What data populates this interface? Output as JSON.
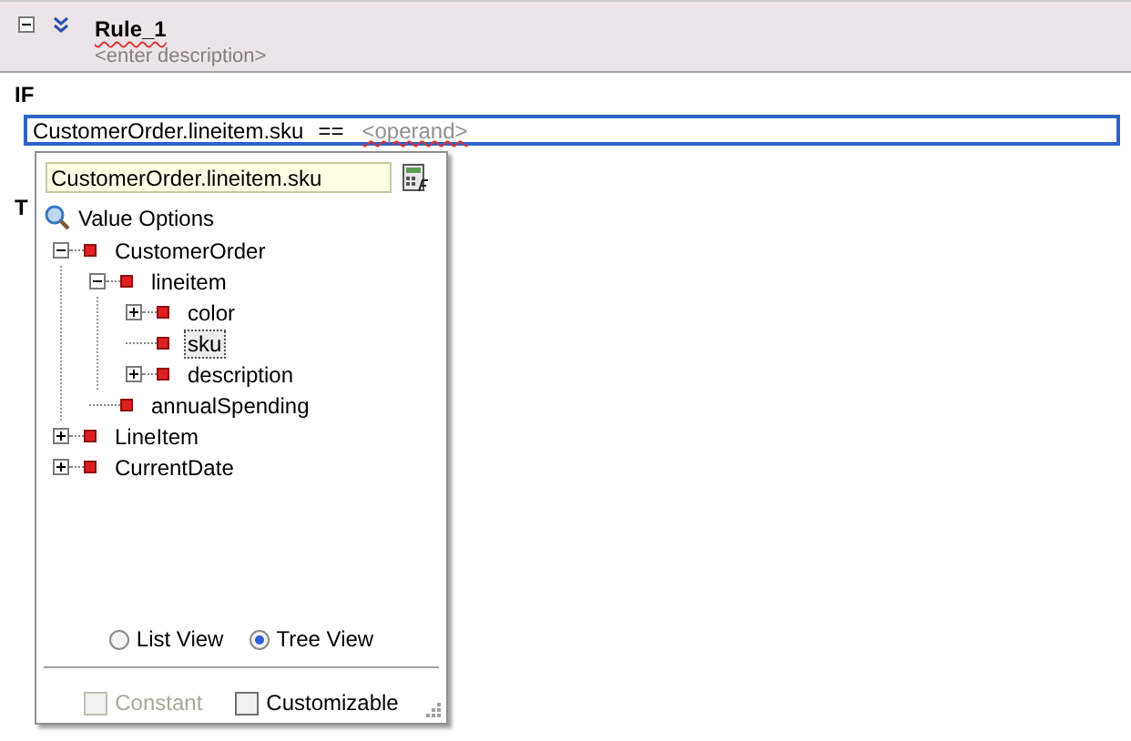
{
  "rule": {
    "title": "Rule_1",
    "description": "<enter description>",
    "expanded": true
  },
  "if_label": "IF",
  "then_label": "T",
  "condition": {
    "left": "CustomerOrder.lineitem.sku",
    "operator": "==",
    "operand_placeholder": "<operand>"
  },
  "popup": {
    "field_value": "CustomerOrder.lineitem.sku",
    "section": "Value Options",
    "tree": [
      {
        "label": "CustomerOrder",
        "expanded": true,
        "selected": false,
        "children": [
          {
            "label": "lineitem",
            "expanded": true,
            "selected": false,
            "children": [
              {
                "label": "color",
                "expanded": false,
                "selected": false
              },
              {
                "label": "sku",
                "selected": true
              },
              {
                "label": "description",
                "expanded": false,
                "selected": false
              }
            ]
          },
          {
            "label": "annualSpending",
            "selected": false
          }
        ]
      },
      {
        "label": "LineItem",
        "expanded": false,
        "selected": false
      },
      {
        "label": "CurrentDate",
        "expanded": false,
        "selected": false
      }
    ],
    "views": [
      {
        "label": "List View",
        "selected": false
      },
      {
        "label": "Tree View",
        "selected": true
      }
    ],
    "options": [
      {
        "label": "Constant",
        "checked": false,
        "disabled": true
      },
      {
        "label": "Customizable",
        "checked": false,
        "disabled": false
      }
    ]
  }
}
